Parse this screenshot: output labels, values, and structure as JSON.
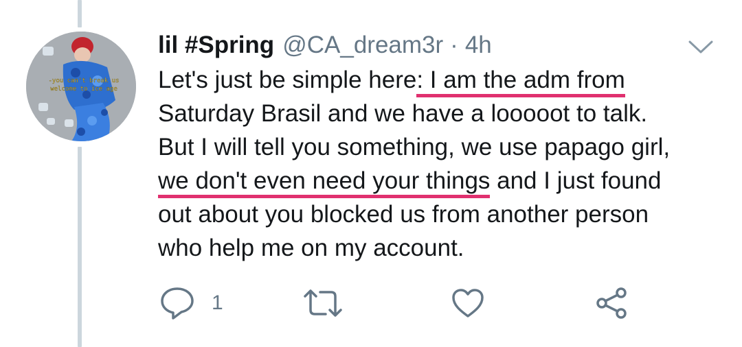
{
  "tweet": {
    "display_name": "lil #Spring",
    "handle": "@CA_dream3r",
    "separator": "·",
    "time": "4h",
    "avatar_overlay_line1": "-you can't break us",
    "avatar_overlay_line2": "welcome to ice age",
    "text_lines": [
      {
        "before": "Let's just be simple here",
        "highlight": ": I am the adm from",
        "after": ""
      },
      {
        "before": "Saturday Brasil and we have a looooot to talk.",
        "highlight": "",
        "after": ""
      },
      {
        "before": "But I will tell you something, we use papago girl,",
        "highlight": "",
        "after": ""
      },
      {
        "before": "",
        "highlight": "we don't even need your things",
        "after": " and I just found"
      },
      {
        "before": "out about you blocked us from another person",
        "highlight": "",
        "after": ""
      },
      {
        "before": "who help me on my account.",
        "highlight": "",
        "after": ""
      }
    ]
  },
  "actions": {
    "reply_count": "1"
  },
  "colors": {
    "highlight_underline": "#e0306f",
    "icon_gray": "#657786",
    "thread_line": "#ccd6dd",
    "text": "#14171a"
  },
  "icons": {
    "reply": "speech-bubble-icon",
    "retweet": "retweet-icon",
    "like": "heart-icon",
    "share": "share-icon",
    "menu": "chevron-down-icon"
  }
}
